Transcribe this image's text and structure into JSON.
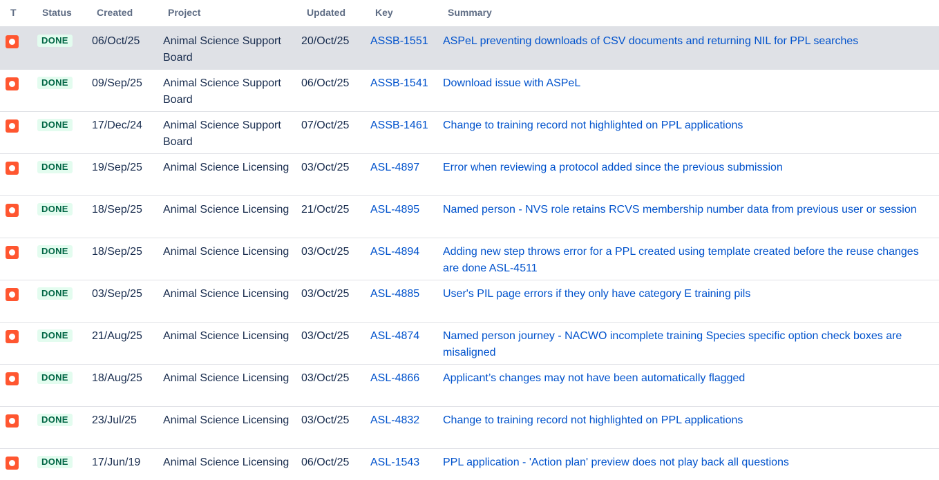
{
  "columns": {
    "type": "T",
    "status": "Status",
    "created": "Created",
    "project": "Project",
    "updated": "Updated",
    "key": "Key",
    "summary": "Summary"
  },
  "issue_type_icon": "bug-icon",
  "colors": {
    "bug_icon": "#ff5630",
    "done_text": "#006644",
    "done_bg": "#e3fcef",
    "link": "#0052cc",
    "row_highlight": "#dfe1e6"
  },
  "rows": [
    {
      "status": "DONE",
      "created": "06/Oct/25",
      "project": "Animal Science Support Board",
      "updated": "20/Oct/25",
      "key": "ASSB-1551",
      "summary": "ASPeL preventing downloads of CSV documents and returning NIL for PPL searches"
    },
    {
      "status": "DONE",
      "created": "09/Sep/25",
      "project": "Animal Science Support Board",
      "updated": "06/Oct/25",
      "key": "ASSB-1541",
      "summary": "Download issue with ASPeL"
    },
    {
      "status": "DONE",
      "created": "17/Dec/24",
      "project": "Animal Science Support Board",
      "updated": "07/Oct/25",
      "key": "ASSB-1461",
      "summary": "Change to training record not highlighted on PPL applications"
    },
    {
      "status": "DONE",
      "created": "19/Sep/25",
      "project": "Animal Science Licensing",
      "updated": "03/Oct/25",
      "key": "ASL-4897",
      "summary": "Error when reviewing a protocol added since the previous submission"
    },
    {
      "status": "DONE",
      "created": "18/Sep/25",
      "project": "Animal Science Licensing",
      "updated": "21/Oct/25",
      "key": "ASL-4895",
      "summary": "Named person - NVS role retains RCVS membership number data from previous user or session"
    },
    {
      "status": "DONE",
      "created": "18/Sep/25",
      "project": "Animal Science Licensing",
      "updated": "03/Oct/25",
      "key": "ASL-4894",
      "summary": "Adding new step throws error for a PPL created using template created before the reuse changes are done ASL-4511"
    },
    {
      "status": "DONE",
      "created": "03/Sep/25",
      "project": "Animal Science Licensing",
      "updated": "03/Oct/25",
      "key": "ASL-4885",
      "summary": "User's PIL page errors if they only have category E training pils"
    },
    {
      "status": "DONE",
      "created": "21/Aug/25",
      "project": "Animal Science Licensing",
      "updated": "03/Oct/25",
      "key": "ASL-4874",
      "summary": "Named person journey - NACWO incomplete training Species specific option check boxes are misaligned"
    },
    {
      "status": "DONE",
      "created": "18/Aug/25",
      "project": "Animal Science Licensing",
      "updated": "03/Oct/25",
      "key": "ASL-4866",
      "summary": "Applicant’s changes may not have been automatically flagged"
    },
    {
      "status": "DONE",
      "created": "23/Jul/25",
      "project": "Animal Science Licensing",
      "updated": "03/Oct/25",
      "key": "ASL-4832",
      "summary": "Change to training record not highlighted on PPL applications"
    },
    {
      "status": "DONE",
      "created": "17/Jun/19",
      "project": "Animal Science Licensing",
      "updated": "06/Oct/25",
      "key": "ASL-1543",
      "summary": "PPL application - 'Action plan' preview does not play back all questions"
    }
  ]
}
